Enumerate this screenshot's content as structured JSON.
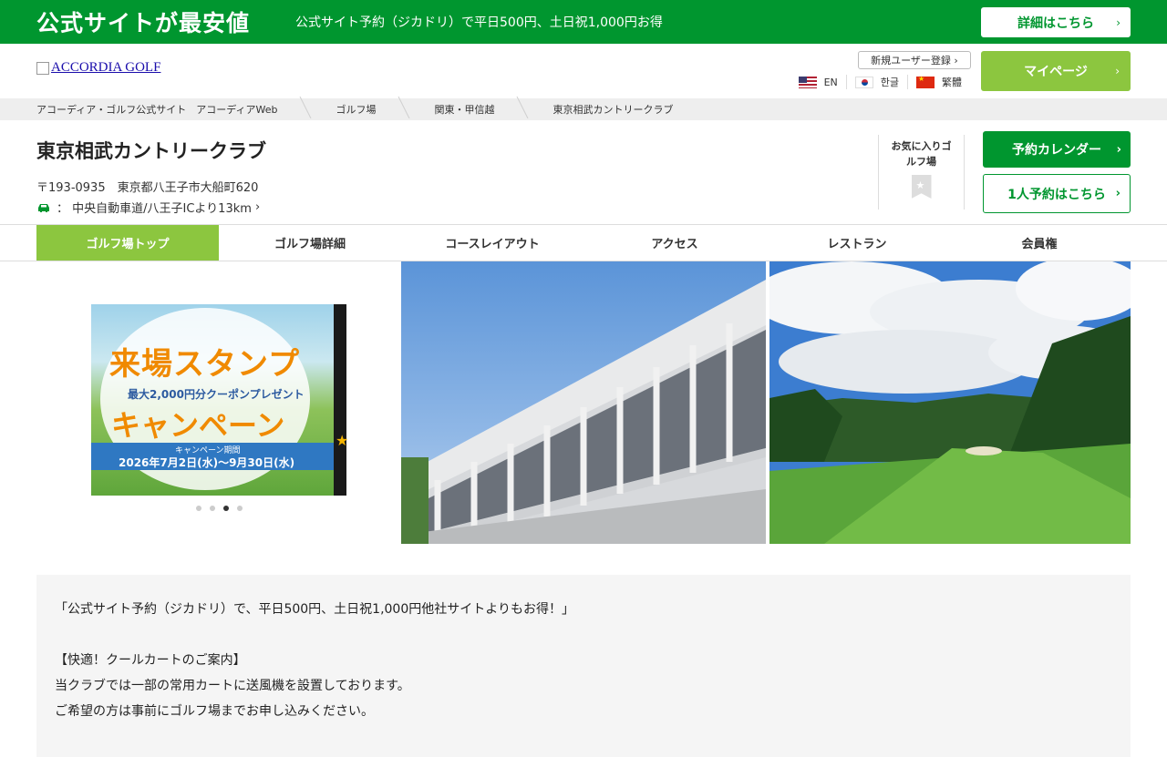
{
  "promo": {
    "title": "公式サイトが最安値",
    "subtitle": "公式サイト予約（ジカドリ）で平日500円、土日祝1,000円お得",
    "detail_button": "詳細はこちら"
  },
  "header": {
    "logo_alt": "ACCORDIA GOLF",
    "register_label": "新規ユーザー登録",
    "languages": [
      {
        "label": "EN",
        "flag": "us-flag-icon"
      },
      {
        "label": "한글",
        "flag": "kr-flag-icon"
      },
      {
        "label": "繁體",
        "flag": "cn-flag-icon"
      }
    ],
    "mypage_label": "マイページ"
  },
  "breadcrumb": [
    "アコーディア・ゴルフ公式サイト　アコーディアWeb",
    "ゴルフ場",
    "関東・甲信越",
    "東京相武カントリークラブ"
  ],
  "course": {
    "name": "東京相武カントリークラブ",
    "address": "〒193-0935　東京都八王子市大船町620",
    "access": "中央自動車道/八王子ICより13km",
    "favorite_label": "お気に入りゴルフ場",
    "calendar_button": "予約カレンダー",
    "solo_button": "1人予約はこちら"
  },
  "tabs": [
    {
      "label": "ゴルフ場トップ",
      "active": true
    },
    {
      "label": "ゴルフ場詳細",
      "active": false
    },
    {
      "label": "コースレイアウト",
      "active": false
    },
    {
      "label": "アクセス",
      "active": false
    },
    {
      "label": "レストラン",
      "active": false
    },
    {
      "label": "会員権",
      "active": false
    }
  ],
  "banner": {
    "line1": "来場スタンプ",
    "line2": "最大2,000円分クーポンプレゼント",
    "line3": "キャンペーン",
    "period_label": "キャンペーン期間",
    "period": "2026年7月2日(水)～9月30日(水)",
    "slide_count": 4,
    "active_slide": 3
  },
  "info": {
    "lines": [
      "「公式サイト予約（ジカドリ）で、平日500円、土日祝1,000円他社サイトよりもお得！」",
      "",
      "【快適！クールカートのご案内】",
      "当クラブでは一部の常用カートに送風機を設置しております。",
      "ご希望の方は事前にゴルフ場までお申し込みください。"
    ]
  },
  "colors": {
    "brand_green": "#00962f",
    "accent_lime": "#8cc63f"
  }
}
